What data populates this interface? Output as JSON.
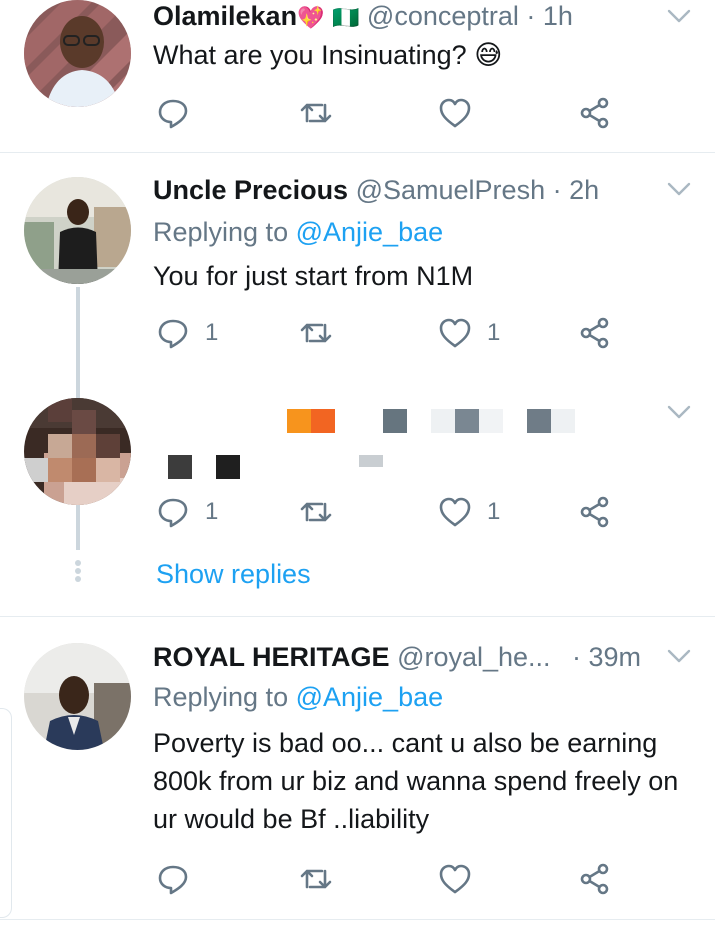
{
  "tweets": [
    {
      "name": "Olamilekan",
      "name_emoji": "💖",
      "flag": "🇳🇬",
      "handle": "@conceptral",
      "time": "· 1h",
      "text": "What are you Insinuating?",
      "text_emoji": "😅",
      "reply_count": "",
      "like_count": ""
    },
    {
      "name": "Uncle Precious",
      "handle": "@SamuelPresh",
      "time": "· 2h",
      "replying_label": "Replying to",
      "replying_to": "@Anjie_bae",
      "text": "You for just start from N1M",
      "reply_count": "1",
      "like_count": "1"
    },
    {
      "name": "",
      "handle": "",
      "time": "",
      "text": "",
      "reply_count": "1",
      "like_count": "1",
      "show_replies": "Show replies"
    },
    {
      "name": "ROYAL HERITAGE",
      "handle": "@royal_he...",
      "time": "· 39m",
      "replying_label": "Replying to",
      "replying_to": "@Anjie_bae",
      "text": "Poverty is bad oo... cant u also be earning 800k from ur biz and wanna spend freely on ur would be Bf  ..liability",
      "reply_count": "",
      "like_count": ""
    }
  ],
  "icons": {
    "reply": "reply-icon",
    "retweet": "retweet-icon",
    "like": "heart-icon",
    "share": "share-icon",
    "more": "chevron-down-icon"
  },
  "colors": {
    "link": "#1da1f2",
    "meta": "#657786",
    "icon": "#657786",
    "divider": "#e6ecf0",
    "thread": "#ccd6dd"
  }
}
